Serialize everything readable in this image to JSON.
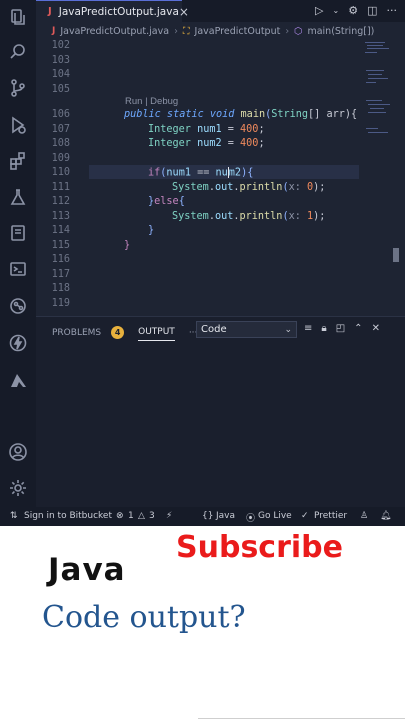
{
  "editor": {
    "tab": {
      "name": "JavaPredictOutput.java",
      "type_glyph": "J"
    },
    "breadcrumb": [
      "JavaPredictOutput.java",
      "JavaPredictOutput",
      "main(String[])"
    ],
    "codelens": "Run | Debug",
    "lines": [
      {
        "num": "102"
      },
      {
        "num": "103"
      },
      {
        "num": "104"
      },
      {
        "num": "105"
      },
      {
        "num": "106"
      },
      {
        "num": "107"
      },
      {
        "num": "108"
      },
      {
        "num": "109"
      },
      {
        "num": "110"
      },
      {
        "num": "111"
      },
      {
        "num": "112"
      },
      {
        "num": "113"
      },
      {
        "num": "114"
      },
      {
        "num": "115"
      },
      {
        "num": "116"
      },
      {
        "num": "117"
      },
      {
        "num": "118"
      },
      {
        "num": "119"
      }
    ],
    "code": {
      "l106": {
        "a": "public static void ",
        "b": "main",
        "c": "(",
        "d": "String",
        "e": "[] arr){"
      },
      "l107": {
        "a": "Integer ",
        "b": "num1",
        "c": " = ",
        "d": "400",
        "e": ";"
      },
      "l108": {
        "a": "Integer ",
        "b": "num2",
        "c": " = ",
        "d": "400",
        "e": ";"
      },
      "l110": {
        "a": "if",
        "b": "(",
        "c": "num1",
        "d": " == ",
        "e": "nu",
        "f": "m2",
        "g": "){"
      },
      "l111": {
        "a": "System",
        "b": ".",
        "c": "out",
        "d": ".",
        "e": "println",
        "f": "(",
        "g": "x: ",
        "h": "0",
        "i": ");"
      },
      "l112": {
        "a": "}",
        "b": "else",
        "c": "{"
      },
      "l113": {
        "a": "System",
        "b": ".",
        "c": "out",
        "d": ".",
        "e": "println",
        "f": "(",
        "g": "x: ",
        "h": "1",
        "i": ");"
      },
      "l114": "}",
      "l115": "}"
    }
  },
  "panel": {
    "problems_label": "PROBLEMS",
    "problems_count": "4",
    "output_label": "OUTPUT",
    "more": "···",
    "channel": "Code"
  },
  "status_bar": {
    "sign_in": "Sign in to Bitbucket",
    "errors": "1",
    "warnings": "3",
    "language": "Java",
    "go_live": "Go Live",
    "prettier": "Prettier"
  },
  "overlay": {
    "subscribe": "Subscribe",
    "java": "Java",
    "question": "Code output?"
  },
  "colors": {
    "editor_bg": "#1e2433",
    "keyword": "#6ea8fe",
    "number": "#f08a5d",
    "subscribe": "#ea1b1b",
    "question": "#23558e"
  }
}
